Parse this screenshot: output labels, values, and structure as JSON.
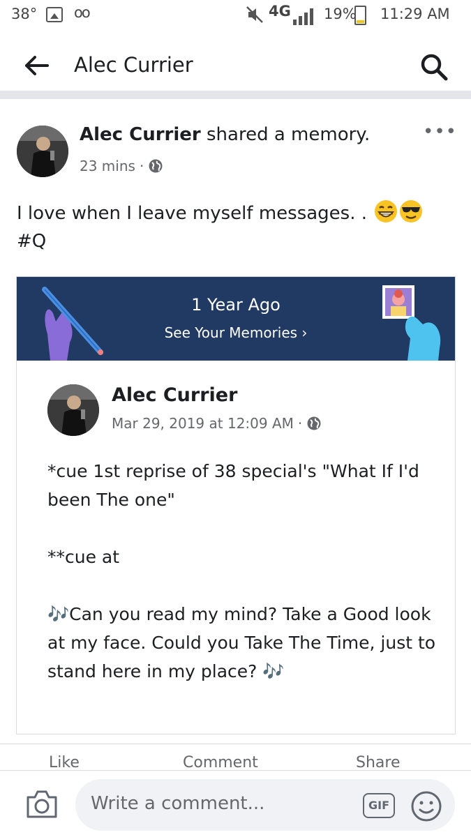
{
  "status_bar": {
    "temperature": "38°",
    "voicemail": "oo",
    "network": "4G",
    "battery_percent": "19%",
    "battery_level": 0.19,
    "time": "11:29 AM"
  },
  "header": {
    "title": "Alec Currier",
    "back_icon": "back-arrow-icon",
    "search_icon": "search-icon"
  },
  "post": {
    "author": "Alec Currier",
    "action": "shared a memory.",
    "time_ago": "23 mins",
    "separator": "·",
    "privacy_icon": "globe-icon",
    "more_label": "•••",
    "text_line1": "I love when I leave myself messages. .",
    "emojis": [
      "grinning-face-emoji",
      "smiling-face-with-sunglasses-emoji"
    ],
    "hashtag": "#Q"
  },
  "memory": {
    "banner_title": "1 Year Ago",
    "banner_link": "See Your Memories ›",
    "banner_color": "#213a63",
    "shared_post": {
      "author": "Alec Currier",
      "date": "Mar 29, 2019 at 12:09 AM",
      "separator": "·",
      "privacy_icon": "globe-icon",
      "paragraphs": [
        "*cue 1st reprise of 38 special's \"What If I'd been The one\"",
        "**cue at",
        "🎶Can you read my mind? Take a Good look at my face. Could you Take The Time, just to stand here in my place? 🎶"
      ]
    }
  },
  "actions": {
    "like": "Like",
    "comment": "Comment",
    "share": "Share"
  },
  "comment_bar": {
    "placeholder": "Write a comment...",
    "gif_label": "GIF",
    "camera_icon": "camera-icon",
    "smiley_icon": "smiley-icon"
  }
}
